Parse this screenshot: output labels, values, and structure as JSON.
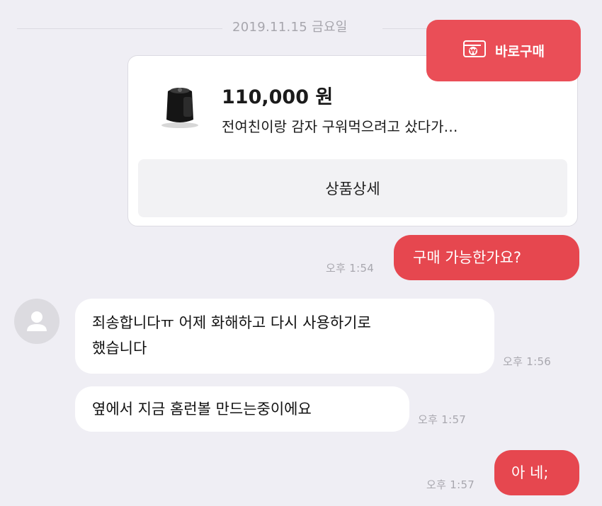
{
  "date_divider": "2019.11.15 금요일",
  "product": {
    "price": "110,000 원",
    "description": "전여친이랑 감자 구워먹으려고 샀다가…",
    "detail_label": "상품상세",
    "thumbnail_icon": "air-fryer-image"
  },
  "buy_now": {
    "label": "바로구매",
    "icon": "wallet-won-icon"
  },
  "messages": [
    {
      "side": "out",
      "text": "구매 가능한가요?",
      "time": "오후 1:54"
    },
    {
      "side": "in",
      "line1": "죄송합니다ㅠ 어제 화해하고 다시 사용하기로",
      "line2": "했습니다",
      "time": "오후 1:56"
    },
    {
      "side": "in",
      "text": "옆에서 지금 홈런볼 만드는중이에요",
      "time": "오후 1:57"
    },
    {
      "side": "out",
      "text": "아 네;",
      "time": "오후 1:57"
    }
  ],
  "colors": {
    "accent": "#e6474f",
    "background": "#efeef4",
    "incoming_bubble": "#ffffff"
  }
}
